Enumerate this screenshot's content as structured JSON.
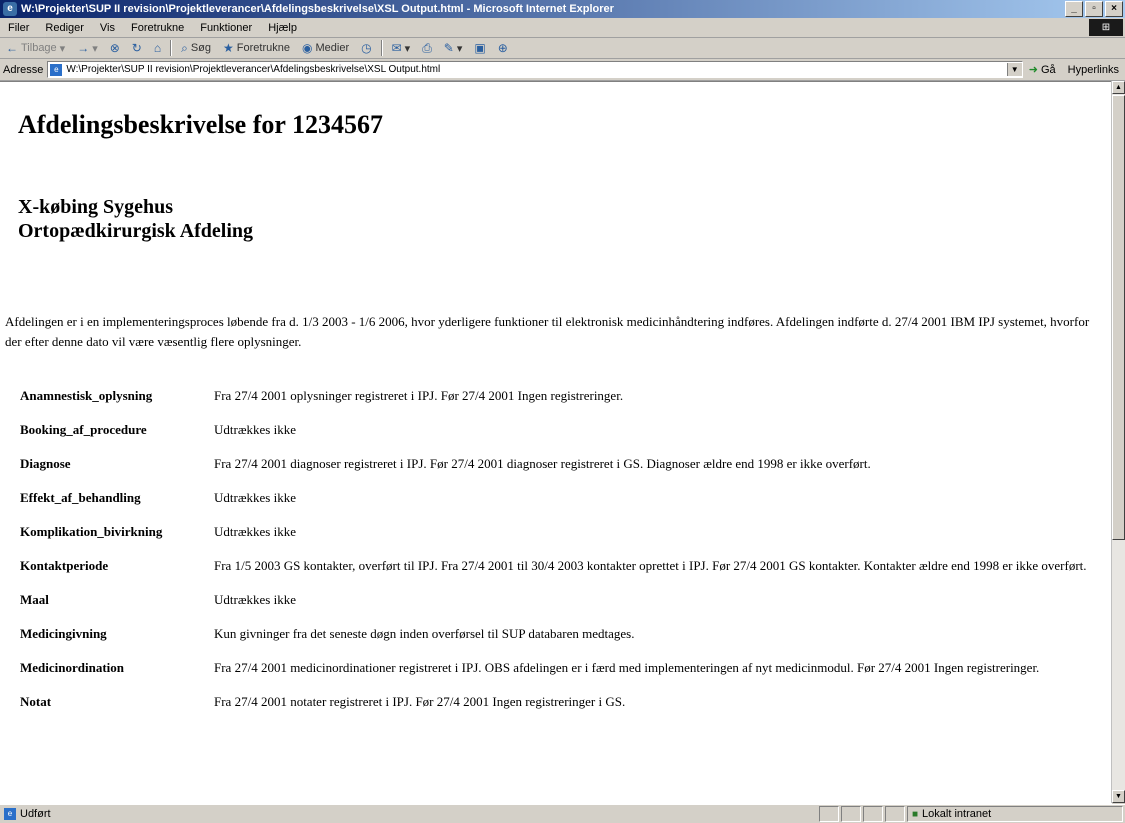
{
  "window": {
    "title": "W:\\Projekter\\SUP II revision\\Projektleverancer\\Afdelingsbeskrivelse\\XSL Output.html - Microsoft Internet Explorer",
    "min_label": "_",
    "max_label": "▫",
    "close_label": "×"
  },
  "menu": [
    "Filer",
    "Rediger",
    "Vis",
    "Foretrukne",
    "Funktioner",
    "Hjælp"
  ],
  "toolbar": {
    "back": "Tilbage",
    "search": "Søg",
    "favorites": "Foretrukne",
    "media": "Medier"
  },
  "address": {
    "label": "Adresse",
    "value": "W:\\Projekter\\SUP II revision\\Projektleverancer\\Afdelingsbeskrivelse\\XSL Output.html",
    "go": "Gå",
    "links": "Hyperlinks"
  },
  "page": {
    "heading": "Afdelingsbeskrivelse for 1234567",
    "hospital": "X-købing Sygehus",
    "department": "Ortopædkirurgisk Afdeling",
    "intro": "Afdelingen er i en implementeringsproces løbende fra d. 1/3 2003 - 1/6 2006, hvor yderligere funktioner til elektronisk medicinhåndtering indføres. Afdelingen indførte d. 27/4 2001 IBM IPJ systemet, hvorfor der efter denne dato vil være væsentlig flere oplysninger.",
    "rows": [
      {
        "key": "Anamnestisk_oplysning",
        "value": "Fra 27/4 2001 oplysninger registreret i IPJ. Før 27/4 2001 Ingen registreringer."
      },
      {
        "key": "Booking_af_procedure",
        "value": "Udtrækkes ikke"
      },
      {
        "key": "Diagnose",
        "value": "Fra 27/4 2001 diagnoser registreret i IPJ. Før 27/4 2001 diagnoser registreret i GS. Diagnoser ældre end 1998 er ikke overført."
      },
      {
        "key": "Effekt_af_behandling",
        "value": "Udtrækkes ikke"
      },
      {
        "key": "Komplikation_bivirkning",
        "value": "Udtrækkes ikke"
      },
      {
        "key": "Kontaktperiode",
        "value": "Fra 1/5 2003 GS kontakter, overført til IPJ. Fra 27/4 2001 til 30/4 2003 kontakter oprettet i IPJ. Før 27/4 2001 GS kontakter. Kontakter ældre end 1998 er ikke overført."
      },
      {
        "key": "Maal",
        "value": "Udtrækkes ikke"
      },
      {
        "key": "Medicingivning",
        "value": "Kun givninger fra det seneste døgn inden overførsel til SUP databaren medtages."
      },
      {
        "key": "Medicinordination",
        "value": "Fra 27/4 2001 medicinordinationer registreret i IPJ. OBS afdelingen er i færd med implementeringen af nyt medicinmodul. Før 27/4 2001 Ingen registreringer."
      },
      {
        "key": "Notat",
        "value": "Fra 27/4 2001 notater registreret i IPJ. Før 27/4 2001 Ingen registreringer i GS."
      }
    ]
  },
  "status": {
    "text": "Udført",
    "zone": "Lokalt intranet"
  }
}
